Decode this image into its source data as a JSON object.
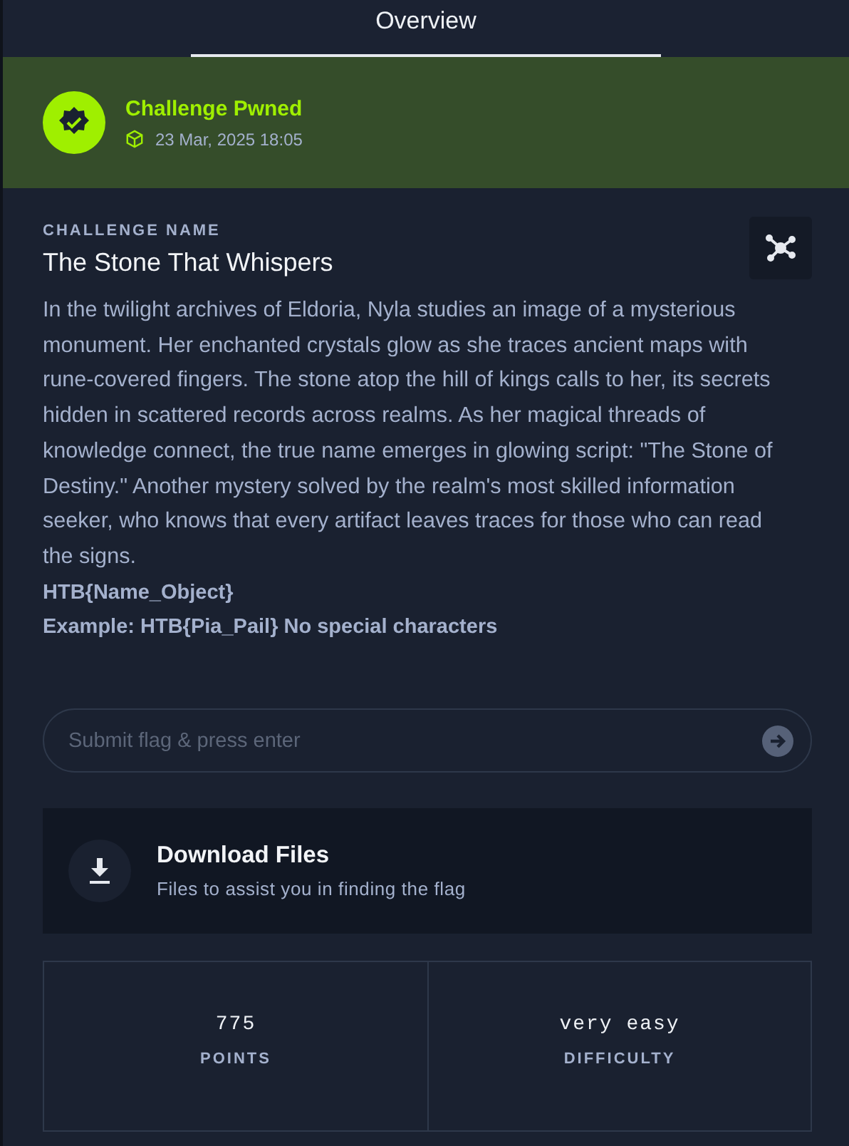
{
  "tabs": [
    {
      "label": "Overview",
      "selected": true
    }
  ],
  "status": {
    "title": "Challenge Pwned",
    "date": "23 Mar, 2025 18:05"
  },
  "challenge": {
    "caption": "CHALLENGE NAME",
    "name": "The Stone That Whispers",
    "description": "In the twilight archives of Eldoria, Nyla studies an image of a mysterious monument. Her enchanted crystals glow as she traces ancient maps with rune-covered fingers. The stone atop the hill of kings calls to her, its secrets hidden in scattered records across realms. As her magical threads of knowledge connect, the true name emerges in glowing script: \"The Stone of Destiny.\" Another mystery solved by the realm's most skilled information seeker, who knows that every artifact leaves traces for those who can read the signs.",
    "notes": [
      "HTB{Name_Object}",
      "Example: HTB{Pia_Pail} No special characters"
    ]
  },
  "flag_field": {
    "placeholder": "Submit flag & press enter"
  },
  "download": {
    "title": "Download Files",
    "subtitle": "Files to assist you in finding the flag"
  },
  "stats": [
    {
      "value": "775",
      "label": "POINTS"
    },
    {
      "value": "very easy",
      "label": "DIFFICULTY"
    }
  ]
}
